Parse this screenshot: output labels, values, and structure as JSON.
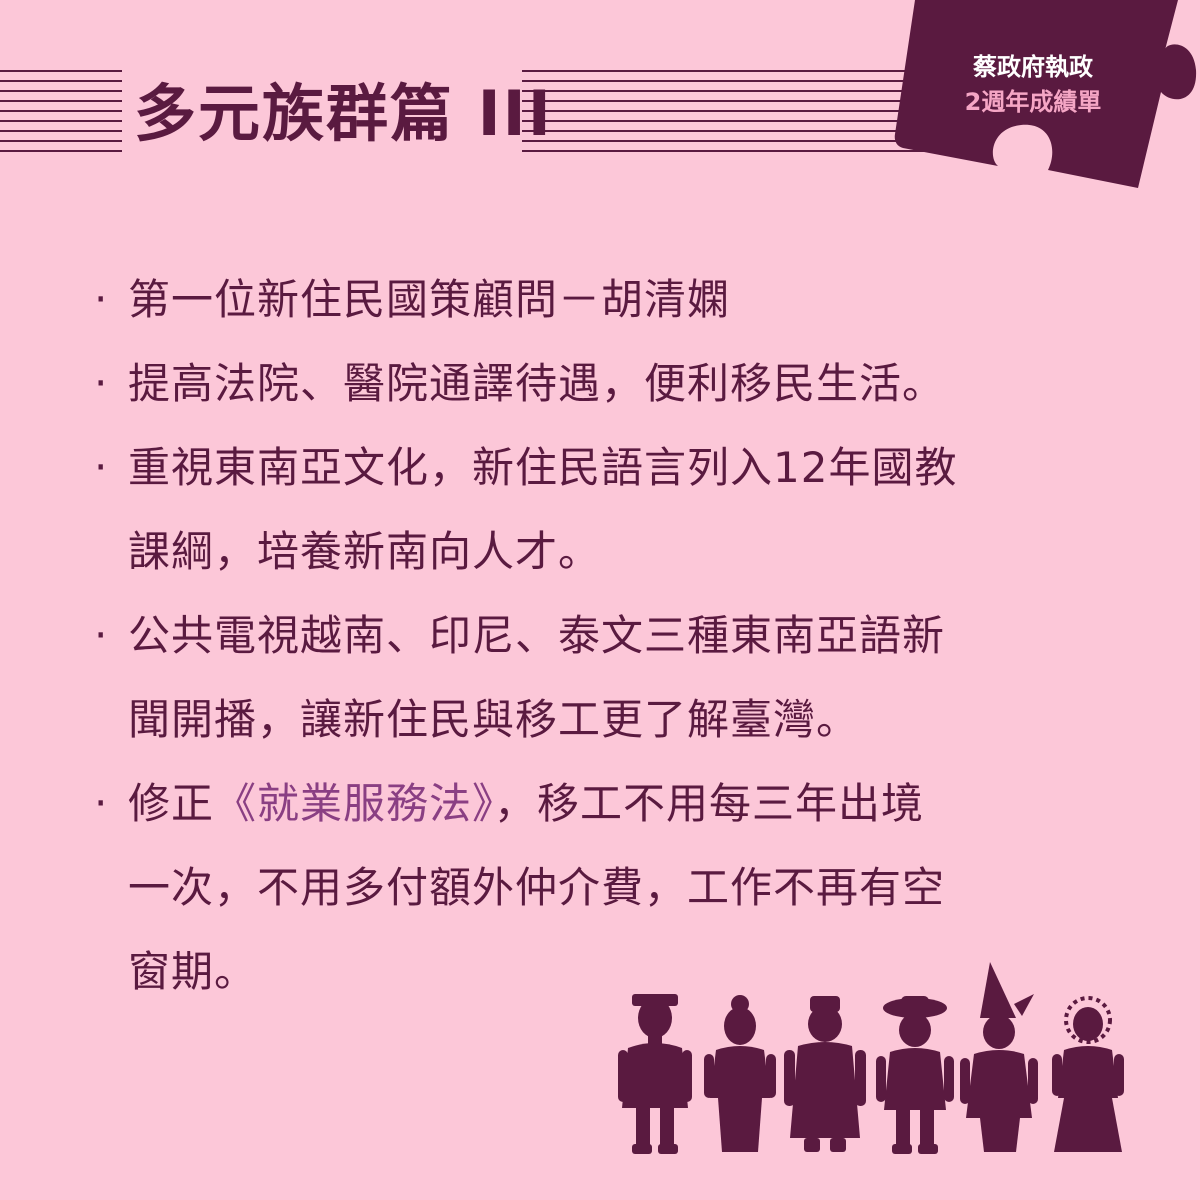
{
  "title": "多元族群篇 III",
  "badge": {
    "line1": "蔡政府執政",
    "line2": "2週年成績單"
  },
  "bullet_symbol": "‧",
  "items": [
    {
      "lines": [
        "第一位新住民國策顧問－胡清嫻"
      ]
    },
    {
      "lines": [
        "提高法院、醫院通譯待遇，便利移民生活。"
      ]
    },
    {
      "lines": [
        "重視東南亞文化，新住民語言列入12年國教",
        "課綱，培養新南向人才。"
      ]
    },
    {
      "lines": [
        "公共電視越南、印尼、泰文三種東南亞語新",
        "聞開播，讓新住民與移工更了解臺灣。"
      ]
    },
    {
      "line1_prefix": "修正",
      "line1_highlight": "《就業服務法》",
      "line1_suffix": "，移工不用每三年出境",
      "line2": "一次，不用多付額外仲介費，工作不再有空",
      "line3": "窗期。"
    }
  ],
  "colors": {
    "background": "#fcc7d8",
    "primary": "#5a1a40",
    "highlight": "#8a3f83",
    "badge_line2": "#f5a6c5"
  },
  "icons": [
    "striped-lines-decoration",
    "puzzle-piece-badge",
    "ethnic-people-group-icon"
  ]
}
